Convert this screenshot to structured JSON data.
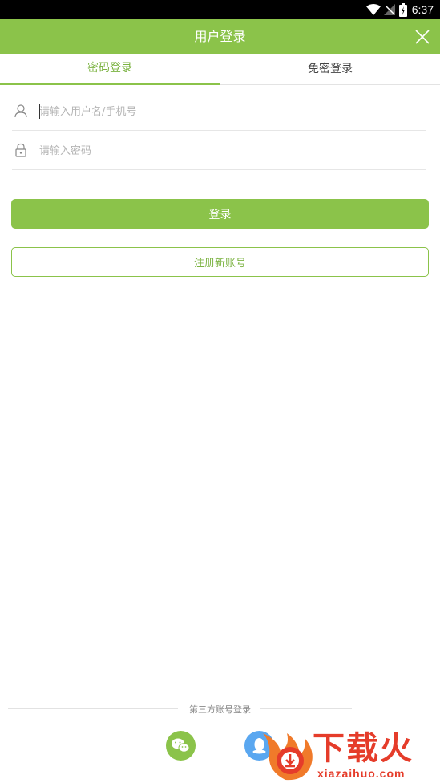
{
  "status_bar": {
    "time": "6:37"
  },
  "app_bar": {
    "title": "用户登录"
  },
  "tabs": [
    {
      "label": "密码登录",
      "active": true
    },
    {
      "label": "免密登录",
      "active": false
    }
  ],
  "form": {
    "username_placeholder": "请输入用户名/手机号",
    "password_placeholder": "请输入密码"
  },
  "buttons": {
    "login_label": "登录",
    "register_label": "注册新账号"
  },
  "third_party": {
    "label": "第三方账号登录",
    "providers": [
      "wechat-icon",
      "qq-icon"
    ]
  },
  "watermark": {
    "text": "下载火",
    "url": "xiazaihuo.com"
  },
  "colors": {
    "accent": "#8bc34a",
    "accent_text": "#7cb342",
    "qq_blue": "#5aa7f0",
    "watermark_red": "#e53c2a"
  }
}
